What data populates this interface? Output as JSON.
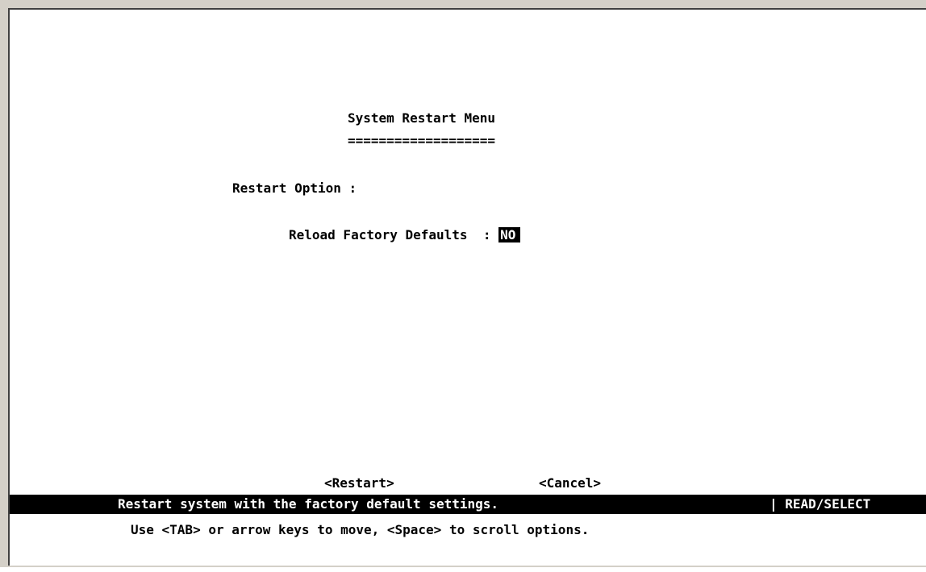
{
  "menu": {
    "title": "System Restart Menu",
    "title_underline": "===================",
    "restart_option_label": "Restart Option :",
    "reload_factory_defaults_label": "Reload Factory Defaults  : ",
    "reload_factory_defaults_value": "NO"
  },
  "buttons": {
    "restart": "<Restart>",
    "cancel": "<Cancel>"
  },
  "status_bar": {
    "description": "Restart system with the factory default settings.",
    "mode": "| READ/SELECT"
  },
  "help": {
    "text": "Use <TAB> or arrow keys to move, <Space> to scroll options."
  }
}
